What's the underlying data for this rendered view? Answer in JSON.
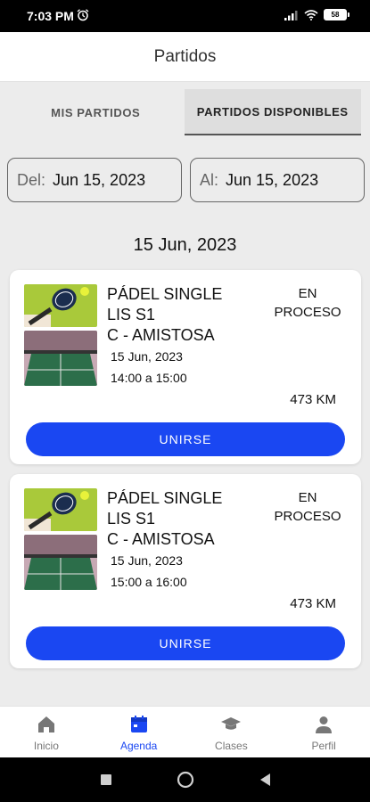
{
  "status_bar": {
    "time": "7:03 PM",
    "battery": "58"
  },
  "header": {
    "title": "Partidos"
  },
  "tabs": [
    {
      "label": "MIS PARTIDOS"
    },
    {
      "label": "PARTIDOS DISPONIBLES"
    }
  ],
  "filters": {
    "from_label": "Del:",
    "from_value": "Jun 15, 2023",
    "to_label": "Al:",
    "to_value": "Jun 15, 2023"
  },
  "section_date": "15 Jun, 2023",
  "matches": [
    {
      "name_lines": [
        "PÁDEL SINGLE",
        "LIS S1",
        "C - AMISTOSA"
      ],
      "date": "15 Jun, 2023",
      "time": "14:00 a 15:00",
      "status_lines": [
        "EN",
        "PROCESO"
      ],
      "distance": "473 KM",
      "action": "UNIRSE"
    },
    {
      "name_lines": [
        "PÁDEL SINGLE",
        "LIS S1",
        "C - AMISTOSA"
      ],
      "date": "15 Jun, 2023",
      "time": "15:00 a 16:00",
      "status_lines": [
        "EN",
        "PROCESO"
      ],
      "distance": "473 KM",
      "action": "UNIRSE"
    }
  ],
  "bottom_nav": [
    {
      "label": "Inicio",
      "icon": "home-icon"
    },
    {
      "label": "Agenda",
      "icon": "calendar-icon"
    },
    {
      "label": "Clases",
      "icon": "graduation-cap-icon"
    },
    {
      "label": "Perfil",
      "icon": "person-icon"
    }
  ],
  "colors": {
    "accent": "#1a47f2",
    "background": "#ececec"
  }
}
